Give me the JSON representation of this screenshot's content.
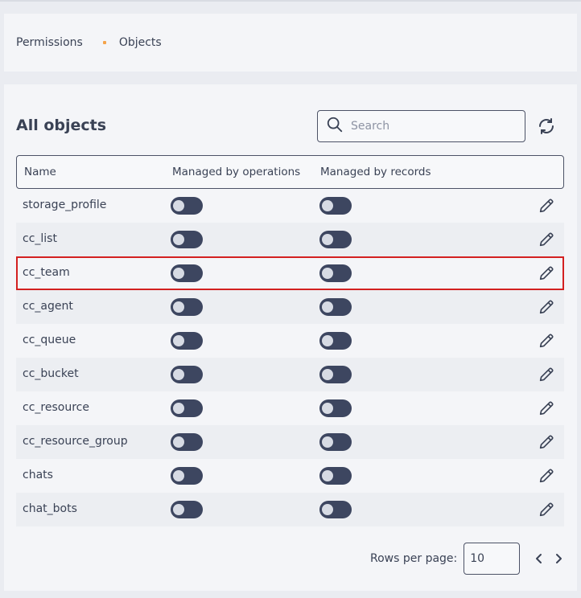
{
  "breadcrumb": {
    "items": [
      "Permissions",
      "Objects"
    ]
  },
  "header": {
    "title": "All objects",
    "search_placeholder": "Search",
    "search_value": ""
  },
  "table": {
    "columns": [
      "Name",
      "Managed by operations",
      "Managed by records"
    ],
    "rows": [
      {
        "name": "storage_profile",
        "by_operations": false,
        "by_records": false
      },
      {
        "name": "cc_list",
        "by_operations": false,
        "by_records": false
      },
      {
        "name": "cc_team",
        "by_operations": false,
        "by_records": false
      },
      {
        "name": "cc_agent",
        "by_operations": false,
        "by_records": false
      },
      {
        "name": "cc_queue",
        "by_operations": false,
        "by_records": false
      },
      {
        "name": "cc_bucket",
        "by_operations": false,
        "by_records": false
      },
      {
        "name": "cc_resource",
        "by_operations": false,
        "by_records": false
      },
      {
        "name": "cc_resource_group",
        "by_operations": false,
        "by_records": false
      },
      {
        "name": "chats",
        "by_operations": false,
        "by_records": false
      },
      {
        "name": "chat_bots",
        "by_operations": false,
        "by_records": false
      }
    ]
  },
  "pagination": {
    "rows_per_page_label": "Rows per page:",
    "rows_per_page_value": "10"
  },
  "icons": {
    "search": "search-icon",
    "refresh": "refresh-icon",
    "edit": "pencil-icon",
    "prev": "chevron-left-icon",
    "next": "chevron-right-icon"
  },
  "colors": {
    "toggle_off": "#3d4660",
    "accent_dot": "#f4a34a",
    "highlight": "#d32020"
  }
}
